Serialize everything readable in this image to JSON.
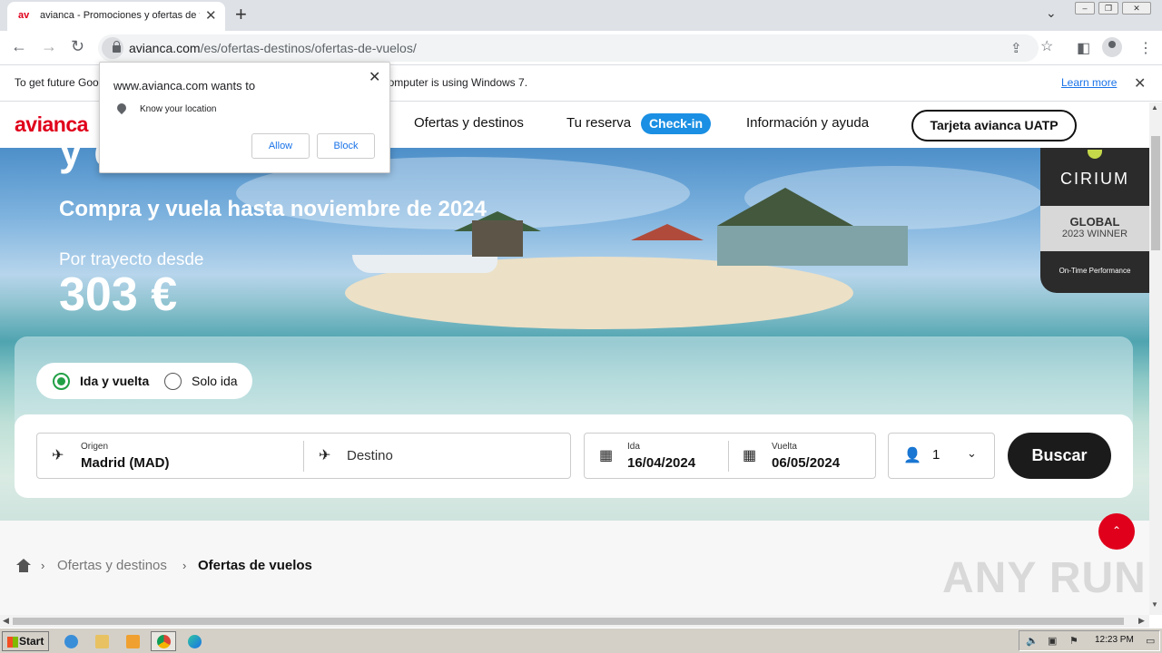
{
  "browser": {
    "tab_title": "avianca - Promociones y ofertas de vuelos",
    "tab_favicon": "av",
    "url_domain": "avianca.com",
    "url_path": "/es/ofertas-destinos/ofertas-de-vuelos/",
    "new_tab": "+",
    "tab_close": "✕"
  },
  "infobar": {
    "text": "To get future Google Chrome updates, you'll need Windows 10 or later. This computer is using Windows 7.",
    "link": "Learn more",
    "close": "✕"
  },
  "permission_popup": {
    "title": "www.avianca.com wants to",
    "permission": "Know your location",
    "allow": "Allow",
    "block": "Block",
    "close": "✕"
  },
  "header": {
    "logo": "avianca",
    "nav": [
      "Ofertas y destinos",
      "Tu reserva",
      "Información y ayuda"
    ],
    "checkin": "Check-in",
    "uatp": "Tarjeta avianca UATP"
  },
  "hero": {
    "headline": "y disfruta",
    "subtitle": "Compra y vuela hasta noviembre de 2024",
    "from_label": "Por trayecto desde",
    "price": "303 €",
    "badge": {
      "brand": "CIRIUM",
      "title": "GLOBAL",
      "year": "2023 WINNER",
      "caption": "On-Time Performance"
    }
  },
  "search": {
    "trip_types": [
      {
        "label": "Ida y vuelta",
        "selected": true
      },
      {
        "label": "Solo ida",
        "selected": false
      }
    ],
    "origin_label": "Origen",
    "origin_value": "Madrid  (MAD)",
    "destination_placeholder": "Destino",
    "depart_label": "Ida",
    "depart_value": "16/04/2024",
    "return_label": "Vuelta",
    "return_value": "06/05/2024",
    "passengers": "1",
    "submit": "Buscar"
  },
  "breadcrumb": {
    "items": [
      "Ofertas y destinos",
      "Ofertas de vuelos"
    ]
  },
  "watermark": "ANY RUN",
  "taskbar": {
    "start": "Start",
    "clock": "12:23 PM"
  },
  "colors": {
    "brand_red": "#e0001b",
    "checkin_blue": "#1a8fe3",
    "radio_green": "#22a046"
  }
}
